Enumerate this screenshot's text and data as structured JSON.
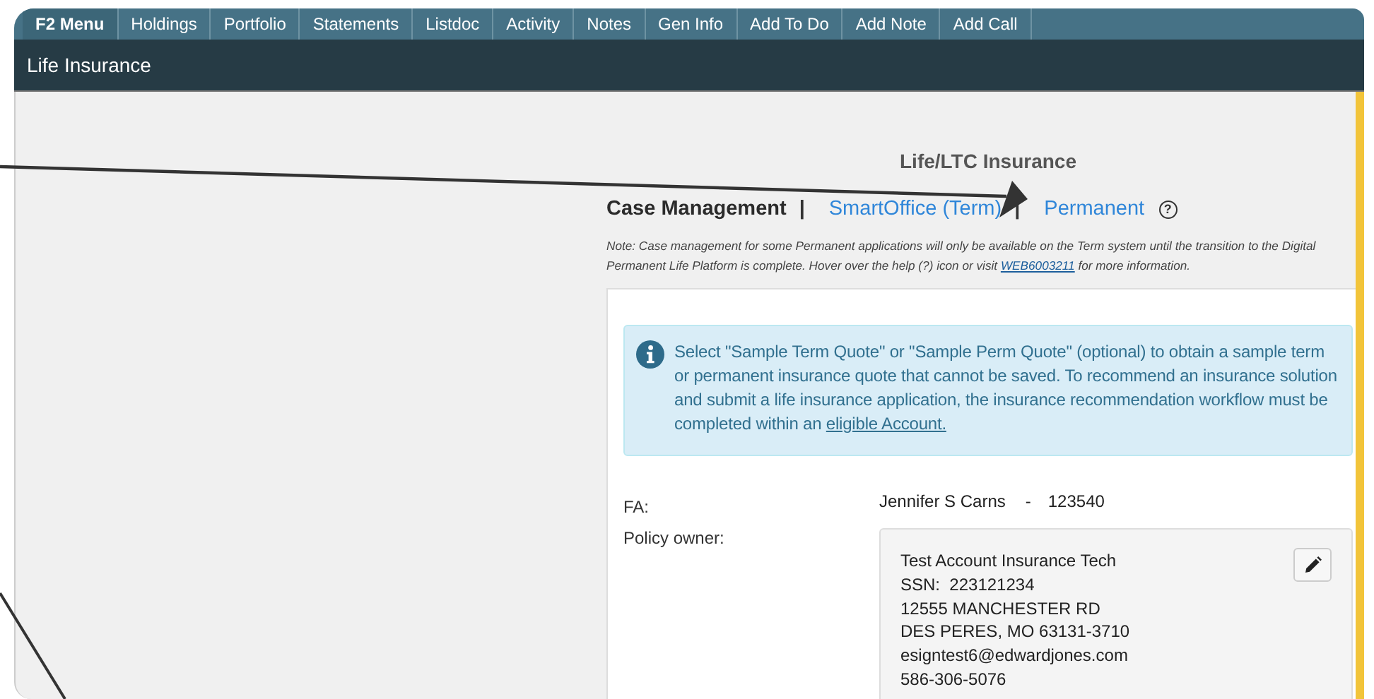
{
  "tabs": [
    {
      "label": "F2 Menu",
      "selected": true
    },
    {
      "label": "Holdings",
      "selected": false
    },
    {
      "label": "Portfolio",
      "selected": false
    },
    {
      "label": "Statements",
      "selected": false
    },
    {
      "label": "Listdoc",
      "selected": false
    },
    {
      "label": "Activity",
      "selected": false
    },
    {
      "label": "Notes",
      "selected": false
    },
    {
      "label": "Gen Info",
      "selected": false
    },
    {
      "label": "Add To Do",
      "selected": false
    },
    {
      "label": "Add Note",
      "selected": false
    },
    {
      "label": "Add Call",
      "selected": false
    }
  ],
  "page_title": "Life Insurance",
  "section_title": "Life/LTC Insurance",
  "case_nav": [
    {
      "kind": "heading",
      "text": "Case Management"
    },
    {
      "kind": "separator",
      "text": "|"
    },
    {
      "kind": "link",
      "text": "SmartOffice (Term)"
    },
    {
      "kind": "separator",
      "text": "|"
    },
    {
      "kind": "link",
      "text": "Permanent"
    },
    {
      "kind": "help",
      "text": "?"
    }
  ],
  "note": {
    "before": "Note: Case management for some Permanent applications will only be available on the Term system until the transition to the Digital Permanent Life Platform is complete. Hover over the help (?) icon or visit ",
    "link": "WEB6003211",
    "after": " for more information."
  },
  "alert": {
    "before": "Select \"Sample Term Quote\" or \"Sample Perm Quote\" (optional) to obtain a sample term or permanent insurance quote that cannot be saved. To recommend an insurance solution and submit a life insurance application, the insurance recommendation workflow must be completed within an ",
    "link": "eligible Account."
  },
  "fa": {
    "label": "FA:",
    "name": "Jennifer S Carns",
    "dash": "-",
    "number": "123540"
  },
  "policy_owner": {
    "label": "Policy owner:",
    "lines": [
      "Test Account Insurance Tech",
      "SSN:  223121234",
      "12555 MANCHESTER RD",
      "DES PERES, MO 63131-3710",
      "esigntest6@edwardjones.com",
      "586-306-5076"
    ]
  }
}
